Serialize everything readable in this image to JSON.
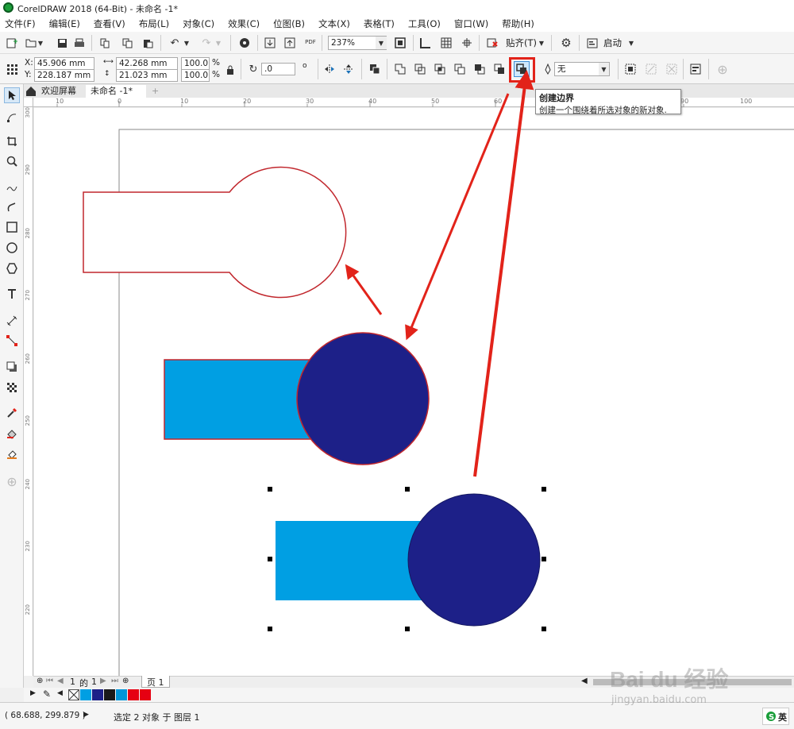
{
  "window": {
    "title": "CorelDRAW 2018 (64-Bit) - 未命名 -1*"
  },
  "menu": [
    "文件(F)",
    "编辑(E)",
    "查看(V)",
    "布局(L)",
    "对象(C)",
    "效果(C)",
    "位图(B)",
    "文本(X)",
    "表格(T)",
    "工具(O)",
    "窗口(W)",
    "帮助(H)"
  ],
  "toolbar": {
    "zoom": "237%",
    "snap_label": "贴齐(T)",
    "launch_label": "启动",
    "pdf_label": "PDF"
  },
  "props": {
    "x_label": "X:",
    "x_value": "45.906 mm",
    "y_label": "Y:",
    "y_value": "228.187 mm",
    "w_value": "42.268 mm",
    "h_value": "21.023 mm",
    "sx_value": "100.0",
    "sy_value": "100.0",
    "pct": "%",
    "angle_value": ".0",
    "deg": "o",
    "outline_value": "无"
  },
  "tabs": {
    "welcome": "欢迎屏幕",
    "doc": "未命名 -1*",
    "add": "+"
  },
  "ruler_top": [
    "10",
    "0",
    "10",
    "20",
    "30",
    "40",
    "50",
    "60",
    "70",
    "80",
    "90",
    "100"
  ],
  "ruler_left": [
    "300",
    "290",
    "280",
    "270",
    "260",
    "250",
    "240",
    "230",
    "220"
  ],
  "tooltip": {
    "title": "创建边界",
    "desc": "创建一个围绕着所选对象的新对象."
  },
  "pagebar": {
    "current": "1",
    "of": "的",
    "total": "1",
    "page_tab": "页 1"
  },
  "palette": [
    "#009fe3",
    "#1d2088",
    "#1a1a1a",
    "#0095d9",
    "#e60012"
  ],
  "status": {
    "coords": "( 68.688, 299.879 )",
    "selection": "选定 2 对象 于 图层 1",
    "ime": "英"
  },
  "watermark": {
    "brand": "Bai du 经验",
    "url": "jingyan.baidu.com"
  },
  "colors": {
    "rect_blue": "#009fe3",
    "circle_navy": "#1d2088",
    "outline_red": "#c1272d",
    "arrow_red": "#e2231a"
  }
}
